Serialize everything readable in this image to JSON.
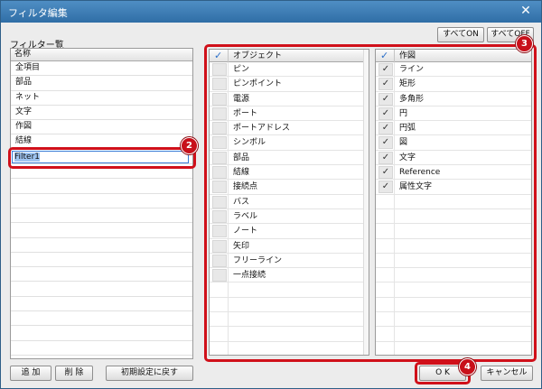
{
  "window": {
    "title": "フィルタ編集",
    "close_glyph": "✕"
  },
  "filter_section": {
    "label": "フィルター覧",
    "column_header": "名称",
    "items": [
      {
        "label": "全項目"
      },
      {
        "label": "部品"
      },
      {
        "label": "ネット"
      },
      {
        "label": "文字"
      },
      {
        "label": "作図"
      },
      {
        "label": "結線"
      }
    ],
    "editing_value": "Filter1"
  },
  "toolbar": {
    "all_on_label": "すべてON",
    "all_off_label": "すべてOFF"
  },
  "objects_table": {
    "header_label": "オブジェクト",
    "header_check_glyph": "✓",
    "items": [
      {
        "label": "ピン",
        "checked": false
      },
      {
        "label": "ピンポイント",
        "checked": false
      },
      {
        "label": "電源",
        "checked": false
      },
      {
        "label": "ポート",
        "checked": false
      },
      {
        "label": "ポートアドレス",
        "checked": false
      },
      {
        "label": "シンボル",
        "checked": false
      },
      {
        "label": "部品",
        "checked": false
      },
      {
        "label": "結線",
        "checked": false
      },
      {
        "label": "接続点",
        "checked": false
      },
      {
        "label": "バス",
        "checked": false
      },
      {
        "label": "ラベル",
        "checked": false
      },
      {
        "label": "ノート",
        "checked": false
      },
      {
        "label": "矢印",
        "checked": false
      },
      {
        "label": "フリーライン",
        "checked": false
      },
      {
        "label": "一点接続",
        "checked": false
      }
    ]
  },
  "drawing_table": {
    "header_label": "作図",
    "header_check_glyph": "✓",
    "items": [
      {
        "label": "ライン",
        "checked": true
      },
      {
        "label": "矩形",
        "checked": true
      },
      {
        "label": "多角形",
        "checked": true
      },
      {
        "label": "円",
        "checked": true
      },
      {
        "label": "円弧",
        "checked": true
      },
      {
        "label": "図",
        "checked": true
      },
      {
        "label": "文字",
        "checked": true
      },
      {
        "label": "Reference",
        "checked": true
      },
      {
        "label": "属性文字",
        "checked": true
      }
    ]
  },
  "footer": {
    "add_label": "追 加",
    "delete_label": "削 除",
    "reset_label": "初期設定に戻す",
    "ok_label": "O K",
    "cancel_label": "キャンセル"
  },
  "annotations": {
    "badge_2": "2",
    "badge_3": "3",
    "badge_4": "4"
  },
  "colors": {
    "annotation_red": "#d0101a",
    "title_blue": "#2f6ea6",
    "check_blue": "#2b6fc9"
  }
}
